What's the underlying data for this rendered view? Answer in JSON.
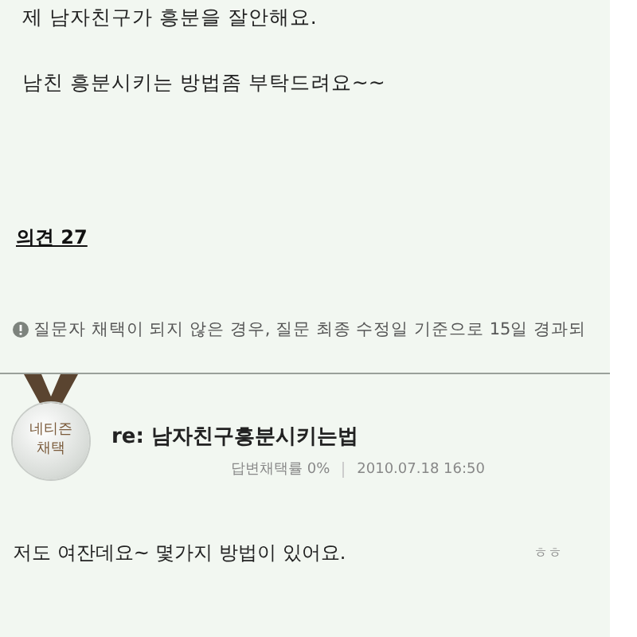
{
  "question": {
    "lines": [
      "제 남자친구가 흥분을 잘안해요.",
      "남친 흥분시키는 방법좀 부탁드려요~~"
    ]
  },
  "opinions": {
    "label": "의견 27"
  },
  "notice": {
    "text": "질문자 채택이 되지 않은 경우, 질문 최종 수정일 기준으로 15일 경과되"
  },
  "answer": {
    "badge": "네티즌 채택",
    "title": "re: 남자친구흥분시키는법",
    "rate": "답변채택률 0%",
    "date": "2010.07.18 16:50",
    "text": "저도 여잔데요~ 몇가지 방법이 있어요.",
    "aside": "ㅎㅎ"
  }
}
